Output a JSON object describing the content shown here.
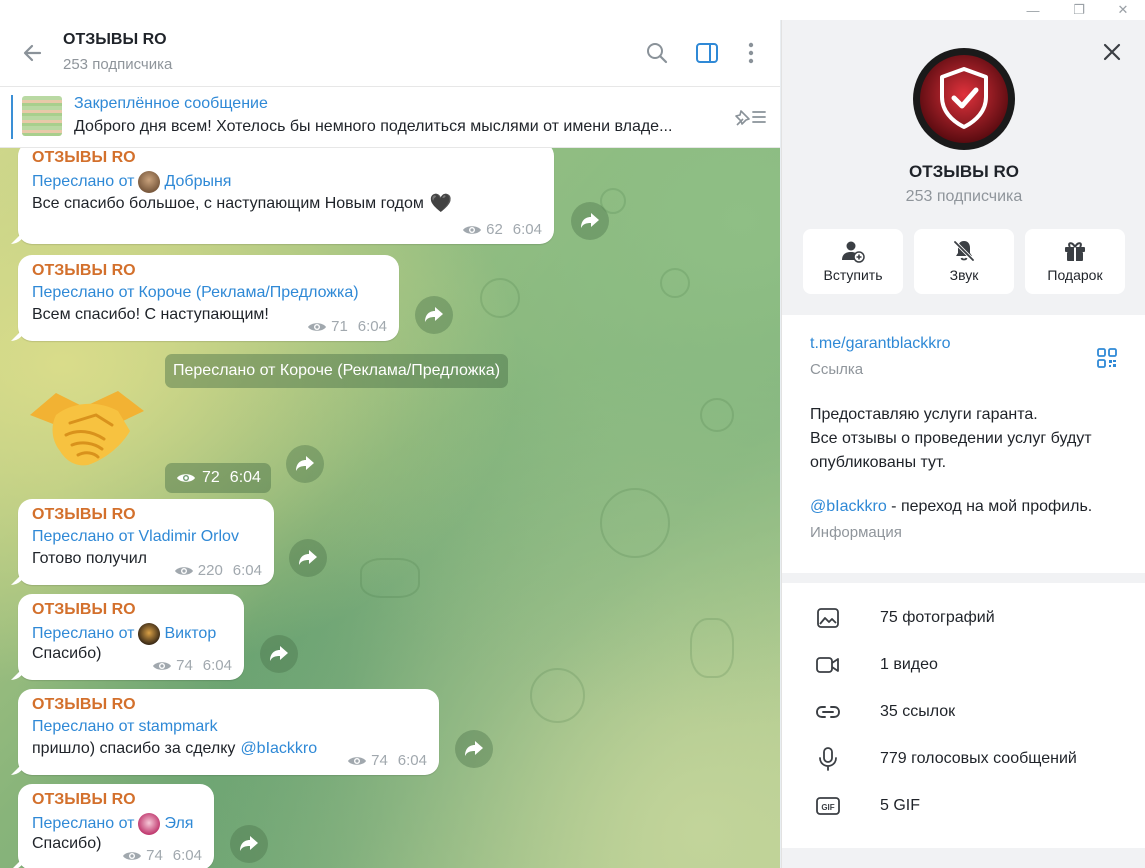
{
  "window": {
    "minimize": "—",
    "restore": "❐",
    "close": "✕"
  },
  "chat_header": {
    "title": "ОТЗЫВЫ RO",
    "subscribers": "253 подписчика"
  },
  "pinned": {
    "title": "Закреплённое сообщение",
    "text": "Доброго дня всем! Хотелось бы немного поделиться мыслями от имени владе..."
  },
  "messages": [
    {
      "author": "ОТЗЫВЫ RO",
      "fwd_prefix": "Переслано от",
      "fwd_name": "Добрыня",
      "text": "Все спасибо большое, с наступающим Новым годом",
      "emoji": "🖤",
      "views": "62",
      "time": "6:04"
    },
    {
      "author": "ОТЗЫВЫ RO",
      "fwd_prefix": "Переслано от",
      "fwd_name": "Короче (Реклама/Предложка)",
      "text": "Всем спасибо! С наступающим!",
      "views": "71",
      "time": "6:04"
    },
    {
      "author": "ОТЗЫВЫ RO",
      "fwd_prefix": "Переслано от",
      "fwd_name": "Vladimir Orlov",
      "text": "Готово получил",
      "views": "220",
      "time": "6:04"
    },
    {
      "author": "ОТЗЫВЫ RO",
      "fwd_prefix": "Переслано от",
      "fwd_name": "Виктор",
      "text": "Спасибо)",
      "views": "74",
      "time": "6:04"
    },
    {
      "author": "ОТЗЫВЫ RO",
      "fwd_prefix": "Переслано от",
      "fwd_name": "stampmark",
      "text": "пришло) спасибо за сделку",
      "mention": "@bIackkro",
      "views": "74",
      "time": "6:04"
    },
    {
      "author": "ОТЗЫВЫ RO",
      "fwd_prefix": "Переслано от",
      "fwd_name": "Эля",
      "text": "Спасибо)",
      "views": "74",
      "time": "6:04"
    }
  ],
  "sticker_message": {
    "fwd_label": "Переслано от Короче (Реклама/Предложка)",
    "views": "72",
    "time": "6:04"
  },
  "panel": {
    "name": "ОТЗЫВЫ RO",
    "subscribers": "253 подписчика",
    "actions": [
      {
        "icon": "add-user-icon",
        "label": "Вступить"
      },
      {
        "icon": "mute-bell-icon",
        "label": "Звук"
      },
      {
        "icon": "gift-icon",
        "label": "Подарок"
      }
    ],
    "link": "t.me/garantblackkro",
    "link_label": "Ссылка",
    "description_lines": [
      "Предоставляю услуги гаранта.",
      "Все отзывы о проведении услуг будут",
      "опубликованы тут."
    ],
    "profile_mention": "@bIackkro",
    "profile_text": " - переход на мой профиль.",
    "info_label": "Информация",
    "media": [
      {
        "icon": "photo-icon",
        "label": "75 фотографий"
      },
      {
        "icon": "video-icon",
        "label": "1 видео"
      },
      {
        "icon": "link-icon",
        "label": "35 ссылок"
      },
      {
        "icon": "mic-icon",
        "label": "779 голосовых сообщений"
      },
      {
        "icon": "gif-icon",
        "label": "5 GIF"
      }
    ]
  },
  "colors": {
    "accent": "#2f89d6",
    "author": "#d3702c"
  }
}
